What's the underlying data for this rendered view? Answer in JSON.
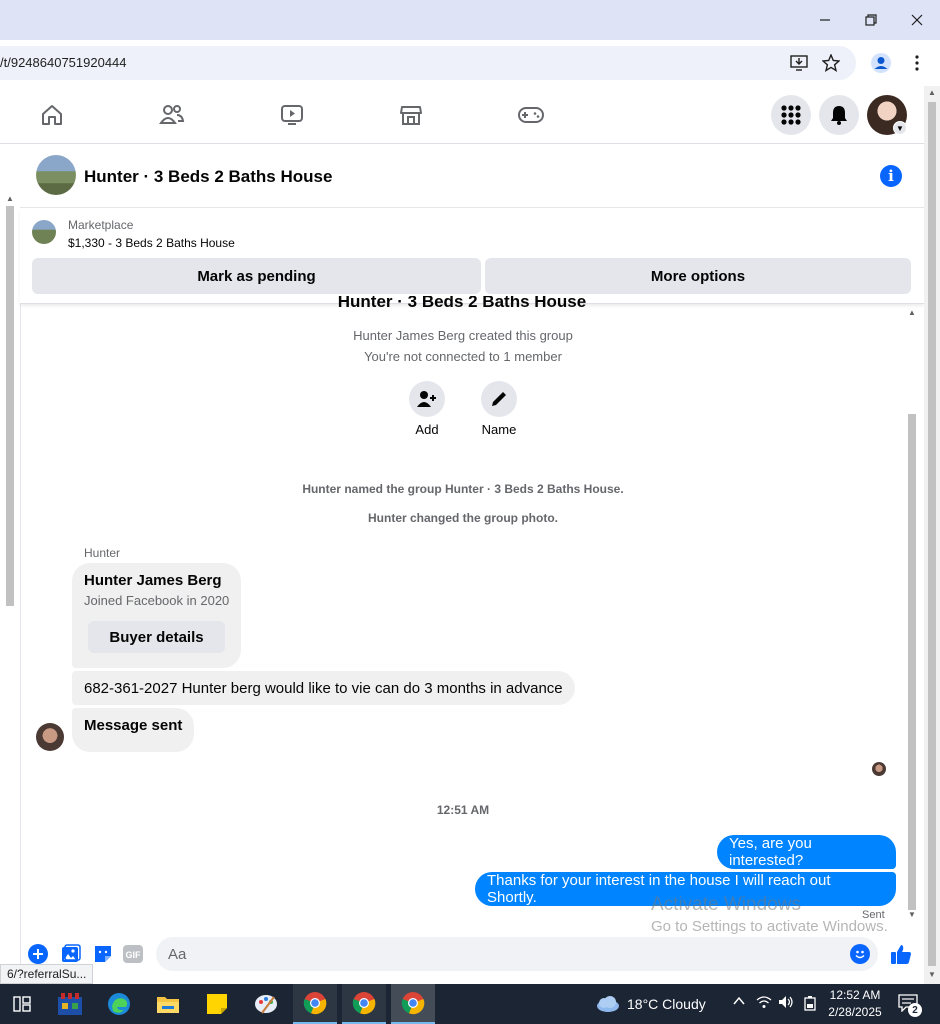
{
  "browser": {
    "url": "/t/9248640751920444",
    "status_url": "6/?referralSu..."
  },
  "chat": {
    "title": "Hunter · 3 Beds 2 Baths House",
    "marketplace_label": "Marketplace",
    "marketplace_listing": "$1,330 - 3 Beds 2 Baths House",
    "mark_pending_label": "Mark as pending",
    "more_options_label": "More options",
    "partial_title": "Hunter · 3 Beds 2 Baths House",
    "created_text": "Hunter James Berg created this group",
    "not_connected_text": "You're not connected to 1 member",
    "add_label": "Add",
    "name_label": "Name",
    "named_event": "Hunter named the group Hunter · 3 Beds 2 Baths House.",
    "photo_event": "Hunter changed the group photo."
  },
  "messages": {
    "sender_name": "Hunter",
    "card_name": "Hunter James Berg",
    "card_sub": "Joined Facebook in 2020",
    "buyer_details_label": "Buyer details",
    "incoming": [
      "682-361-2027 Hunter berg would like to vie can do 3 months in advance",
      "Message sent"
    ],
    "timestamp": "12:51 AM",
    "outgoing": [
      "Yes, are you interested?",
      "Thanks for your interest in the house I will reach out Shortly."
    ],
    "sent_label": "Sent"
  },
  "watermark": {
    "line1": "Activate Windows",
    "line2": "Go to Settings to activate Windows."
  },
  "composer": {
    "placeholder": "Aa",
    "gif_label": "GIF"
  },
  "taskbar": {
    "weather": "18°C  Cloudy",
    "time": "12:52 AM",
    "date": "2/28/2025",
    "notification_count": "2"
  },
  "colors": {
    "messenger_blue": "#0084ff",
    "facebook_blue": "#0866ff",
    "bubble_grey": "#f0f0f0"
  }
}
